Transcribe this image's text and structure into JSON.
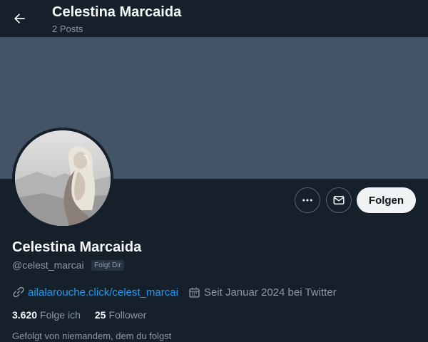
{
  "header": {
    "title": "Celestina Marcaida",
    "post_count": "2 Posts"
  },
  "profile": {
    "name": "Celestina Marcaida",
    "handle": "@celest_marcai",
    "follows_you_badge": "Folgt Dir",
    "website": "ailalarouche.click/celest_marcai",
    "joined": "Seit Januar 2024 bei Twitter",
    "following_count": "3.620",
    "following_label": "Folge ich",
    "followers_count": "25",
    "followers_label": "Follower",
    "followed_by_text": "Gefolgt von niemandem, dem du folgst"
  },
  "actions": {
    "more_icon": "more-icon",
    "message_icon": "mail-icon",
    "follow_label": "Folgen"
  },
  "colors": {
    "background": "#15202b",
    "banner": "#425466",
    "accent": "#1d9bf0",
    "muted_text": "#8b98a5"
  }
}
